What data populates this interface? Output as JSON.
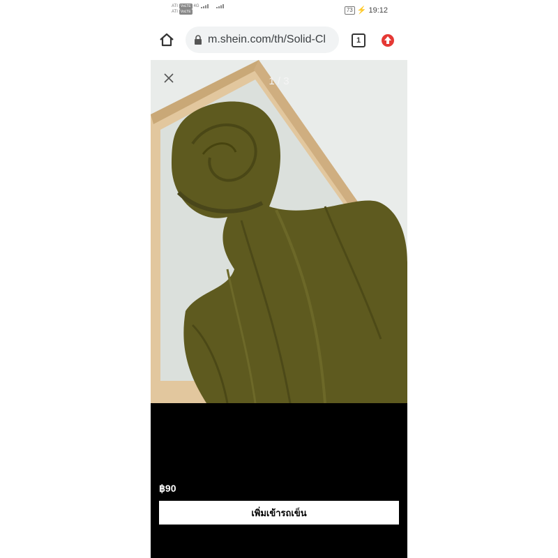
{
  "status_bar": {
    "carrier_label_1": "ATI",
    "carrier_label_2": "ATI",
    "volte_1": "VoLTE",
    "volte_2": "VoLTE",
    "network_type": "4G",
    "battery": "73",
    "time": "19:12"
  },
  "browser": {
    "url": "m.shein.com/th/Solid-Cl",
    "tab_count": "1",
    "icons": [
      "home-icon",
      "lock-icon",
      "tab-switcher-icon",
      "extension-icon"
    ]
  },
  "viewer": {
    "counter": "1 / 3",
    "close_icon": "close-icon"
  },
  "product": {
    "price": "฿90",
    "add_to_cart_label": "เพิ่มเข้ารถเข็น",
    "scarf_color": "#5e5a1f"
  }
}
